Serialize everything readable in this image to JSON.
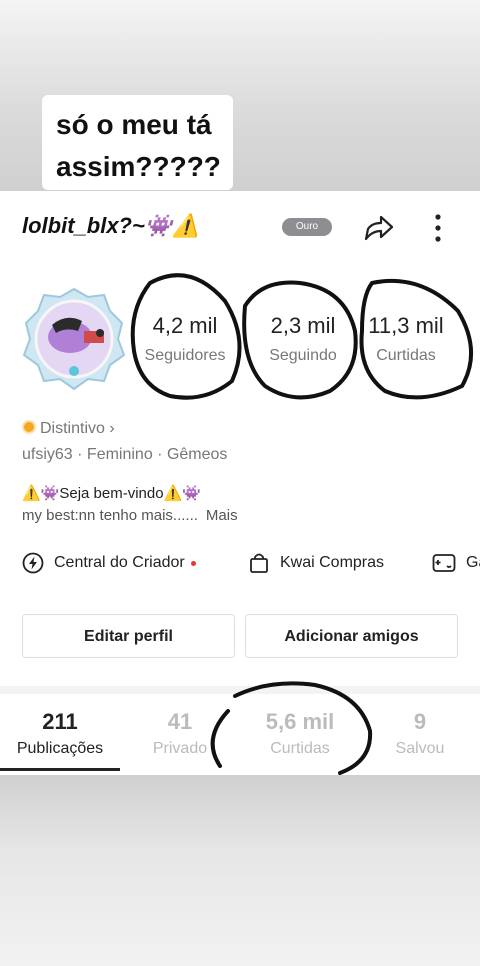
{
  "caption": {
    "line1": "só o meu tá",
    "line2": "assim?????"
  },
  "profile": {
    "username": "lolbit_blx?~👾⚠️",
    "tier_badge": "Ouro",
    "stats": [
      {
        "value": "4,2 mil",
        "label": "Seguidores"
      },
      {
        "value": "2,3 mil",
        "label": "Seguindo"
      },
      {
        "value": "11,3 mil",
        "label": "Curtidas"
      }
    ],
    "distintivo": "Distintivo ›",
    "meta": "ufsiy63 · Feminino · Gêmeos",
    "bio_line1": "⚠️👾Seja bem-vindo⚠️👾",
    "bio_line2": "my best:nn tenho mais......",
    "bio_more": "Mais"
  },
  "quick_links": [
    {
      "label": "Central do Criador",
      "icon": "lightning-icon"
    },
    {
      "label": "Kwai Compras",
      "icon": "shopping-bag-icon"
    },
    {
      "label": "Ga",
      "icon": "gamepad-icon"
    }
  ],
  "buttons": {
    "edit": "Editar perfil",
    "add_friends": "Adicionar amigos"
  },
  "tabs": [
    {
      "value": "211",
      "label": "Publicações",
      "active": true
    },
    {
      "value": "41",
      "label": "Privado"
    },
    {
      "value": "5,6 mil",
      "label": "Curtidas"
    },
    {
      "value": "9",
      "label": "Salvou"
    }
  ],
  "colors": {
    "accent_red": "#e53935",
    "badge_gold": "#f5a623",
    "scribble": "#111111"
  }
}
